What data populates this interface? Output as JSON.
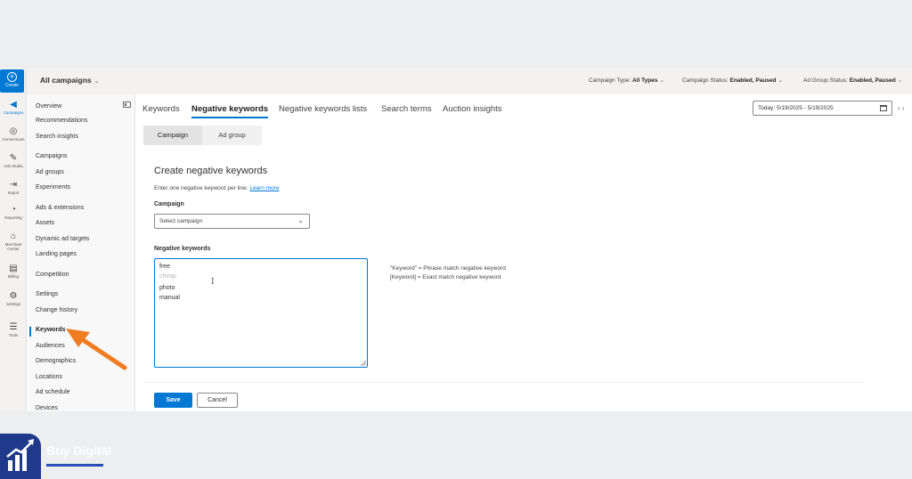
{
  "rail": {
    "create_label": "Create",
    "items": [
      {
        "label": "Campaigns",
        "icon": "megaphone-icon"
      },
      {
        "label": "Conversions",
        "icon": "target-icon"
      },
      {
        "label": "Ads Studio",
        "icon": "edit-icon"
      },
      {
        "label": "Import",
        "icon": "import-icon"
      },
      {
        "label": "Reporting",
        "icon": "chart-icon"
      },
      {
        "label": "Merchant Center",
        "icon": "store-icon"
      },
      {
        "label": "Billing",
        "icon": "billing-icon"
      },
      {
        "label": "Settings",
        "icon": "gear-icon"
      },
      {
        "label": "Tools",
        "icon": "tools-icon"
      }
    ]
  },
  "topbar": {
    "campaign_selector": "All campaigns",
    "filters": [
      {
        "label": "Campaign Type:",
        "value": "All Types"
      },
      {
        "label": "Campaign Status:",
        "value": "Enabled, Paused"
      },
      {
        "label": "Ad Group Status:",
        "value": "Enabled, Paused"
      }
    ]
  },
  "leftnav": {
    "items": [
      {
        "label": "Overview"
      },
      {
        "label": "Recommendations"
      },
      {
        "label": "Search insights"
      },
      {
        "label": "Campaigns"
      },
      {
        "label": "Ad groups"
      },
      {
        "label": "Experiments"
      },
      {
        "label": "Ads & extensions"
      },
      {
        "label": "Assets"
      },
      {
        "label": "Dynamic ad targets"
      },
      {
        "label": "Landing pages"
      },
      {
        "label": "Competition"
      },
      {
        "label": "Settings"
      },
      {
        "label": "Change history"
      },
      {
        "label": "Keywords",
        "active": true
      },
      {
        "label": "Audiences"
      },
      {
        "label": "Demographics"
      },
      {
        "label": "Locations"
      },
      {
        "label": "Ad schedule"
      },
      {
        "label": "Devices"
      }
    ]
  },
  "tabs": [
    {
      "label": "Keywords"
    },
    {
      "label": "Negative keywords",
      "active": true
    },
    {
      "label": "Negative keywords lists"
    },
    {
      "label": "Search terms"
    },
    {
      "label": "Auction insights"
    }
  ],
  "date_range": "Today: 5/19/2025 - 5/19/2025",
  "subtabs": [
    {
      "label": "Campaign",
      "active": true
    },
    {
      "label": "Ad group"
    }
  ],
  "form": {
    "title": "Create negative keywords",
    "description": "Enter one negative keyword per line.",
    "learn_more": "Learn more",
    "campaign_label": "Campaign",
    "campaign_placeholder": "Select campaign",
    "negative_label": "Negative keywords",
    "keywords": [
      {
        "text": "free",
        "faded": false
      },
      {
        "text": "cheap",
        "faded": true
      },
      {
        "text": "photo",
        "faded": false
      },
      {
        "text": "manual",
        "faded": false
      }
    ],
    "hints": [
      "\"Keyword\" = Phrase match negative keyword",
      "[Keyword] = Exact match negative keyword"
    ],
    "save_label": "Save",
    "cancel_label": "Cancel"
  },
  "watermark": {
    "text": "Buy Digital"
  },
  "colors": {
    "accent": "#0078d4",
    "annotation_arrow": "#f07c22",
    "watermark": "#1f3a8a"
  }
}
